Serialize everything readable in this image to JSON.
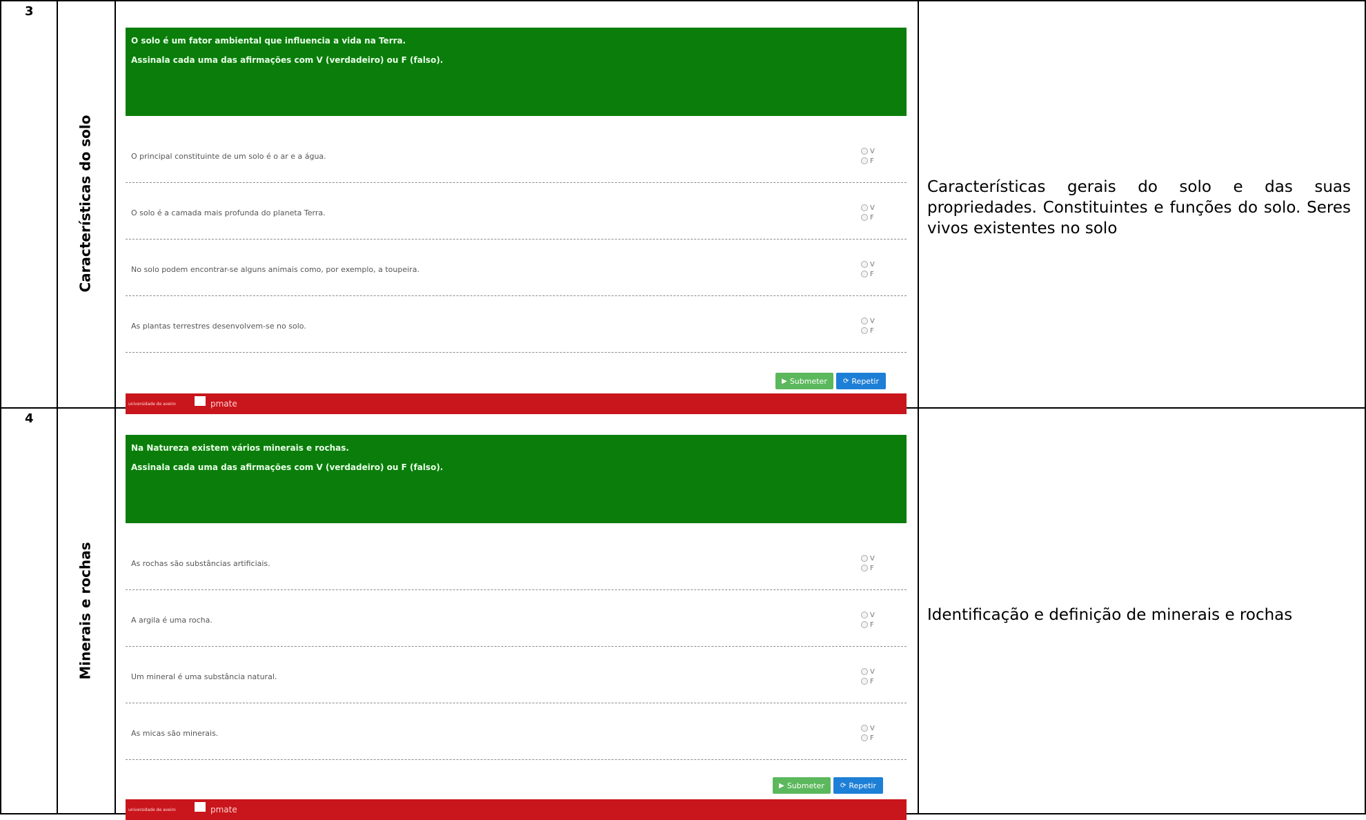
{
  "rows": [
    {
      "number": "3",
      "title": "Características do solo",
      "description": "Características gerais do solo e das suas propriedades. Constituintes e funções do solo. Seres vivos existentes no solo",
      "quiz": {
        "intro": "O solo é um fator ambiental que influencia a vida na Terra.",
        "instruction": "Assinala cada uma das afirmações com V (verdadeiro) ou F (falso).",
        "statements": [
          "O principal constituinte de um solo é o ar e a água.",
          "O solo é a camada mais profunda do planeta Terra.",
          "No solo podem encontrar-se alguns animais como, por exemplo, a toupeira.",
          "As plantas terrestres desenvolvem-se no solo."
        ],
        "option_true": "V",
        "option_false": "F",
        "submit_label": "Submeter",
        "repeat_label": "Repetir",
        "footer_uni": "universidade de aveiro",
        "footer_brand": "pmate"
      }
    },
    {
      "number": "4",
      "title": "Minerais e rochas",
      "description": "Identificação e definição de minerais e rochas",
      "quiz": {
        "intro": "Na Natureza existem vários minerais e rochas.",
        "instruction": "Assinala cada uma das afirmações com V (verdadeiro) ou F (falso).",
        "statements": [
          "As rochas são substâncias artificiais.",
          "A argila é uma rocha.",
          "Um mineral é uma substância natural.",
          "As micas são minerais."
        ],
        "option_true": "V",
        "option_false": "F",
        "submit_label": "Submeter",
        "repeat_label": "Repetir",
        "footer_uni": "universidade de aveiro",
        "footer_brand": "pmate"
      }
    }
  ],
  "colors": {
    "quiz_header": "#0b7d0b",
    "submit": "#5cb85c",
    "repeat": "#1e7fd6",
    "footer": "#c9161c"
  }
}
